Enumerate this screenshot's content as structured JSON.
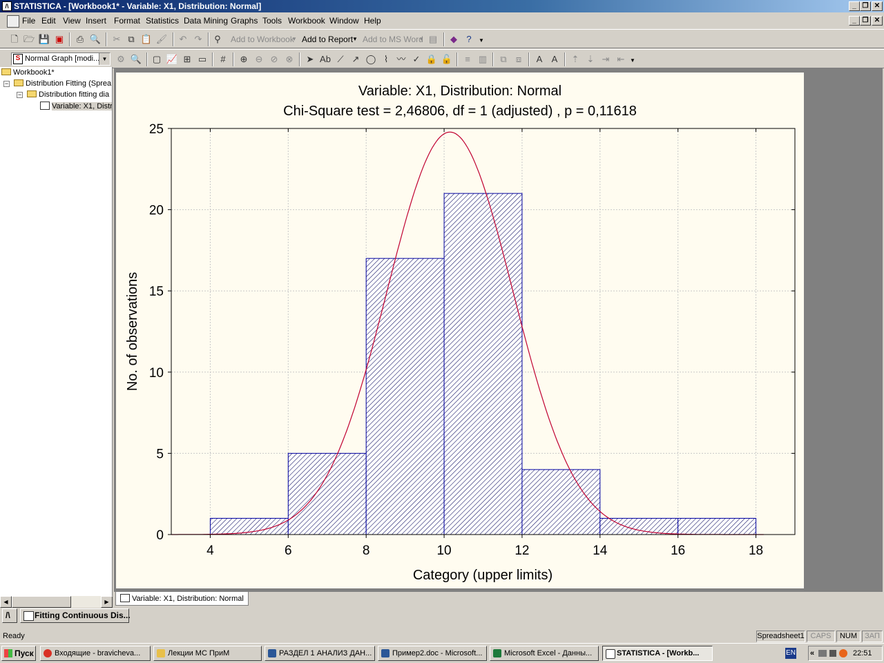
{
  "window": {
    "title": "STATISTICA - [Workbook1* - Variable: X1, Distribution: Normal]"
  },
  "menu": [
    "File",
    "Edit",
    "View",
    "Insert",
    "Format",
    "Statistics",
    "Data Mining",
    "Graphs",
    "Tools",
    "Workbook",
    "Window",
    "Help"
  ],
  "toolbar1": {
    "add_to_workbook": "Add to Workbook",
    "add_to_report": "Add to Report",
    "add_to_ms_word": "Add to MS Word"
  },
  "toolbar2": {
    "graph_combo": "Normal Graph [modi..."
  },
  "tree": {
    "root": "Workbook1*",
    "child": "Distribution Fitting (Sprea",
    "grandchild": "Distribution fitting dia",
    "leaf": "Variable: X1, Distri"
  },
  "doc_tab": "Variable: X1, Distribution: Normal",
  "mdi_button": "Fitting Continuous Dis...",
  "status": {
    "text": "Ready",
    "panels": [
      "Spreadsheet1",
      "CAPS",
      "NUM",
      "ЗАП"
    ]
  },
  "taskbar": {
    "start": "Пуск",
    "tasks": [
      {
        "label": "Входящие - bravicheva...",
        "color": "#d93025"
      },
      {
        "label": "Лекции МС ПриМ",
        "color": "#e8c04a"
      },
      {
        "label": "РАЗДЕЛ 1 АНАЛИЗ ДАН...",
        "color": "#2b5797"
      },
      {
        "label": "Пример2.doc - Microsoft...",
        "color": "#2b5797"
      },
      {
        "label": "Microsoft Excel - Данны...",
        "color": "#1d7a3a"
      },
      {
        "label": "STATISTICA - [Workb...",
        "color": "#555555"
      }
    ],
    "lang": "EN",
    "clock": "22:51"
  },
  "chart_data": {
    "type": "bar",
    "title": "Variable: X1, Distribution: Normal",
    "subtitle": "Chi-Square test = 2,46806, df = 1 (adjusted) , p = 0,11618",
    "xlabel": "Category (upper limits)",
    "ylabel": "No. of observations",
    "xlim": [
      3,
      19
    ],
    "ylim": [
      0,
      25
    ],
    "xticks": [
      4,
      6,
      8,
      10,
      12,
      14,
      16,
      18
    ],
    "yticks": [
      0,
      5,
      10,
      15,
      20,
      25
    ],
    "bar_edges": [
      [
        4,
        6
      ],
      [
        6,
        8
      ],
      [
        8,
        10
      ],
      [
        10,
        12
      ],
      [
        12,
        14
      ],
      [
        14,
        16
      ],
      [
        16,
        18
      ]
    ],
    "values": [
      1,
      5,
      17,
      21,
      4,
      1,
      1
    ],
    "fit_curve": {
      "name": "Normal",
      "mean": 10.15,
      "sd": 1.61,
      "n": 50,
      "bin_width": 2
    },
    "bar_color": "#0000a0",
    "curve_color": "#c00030",
    "grid": true
  }
}
